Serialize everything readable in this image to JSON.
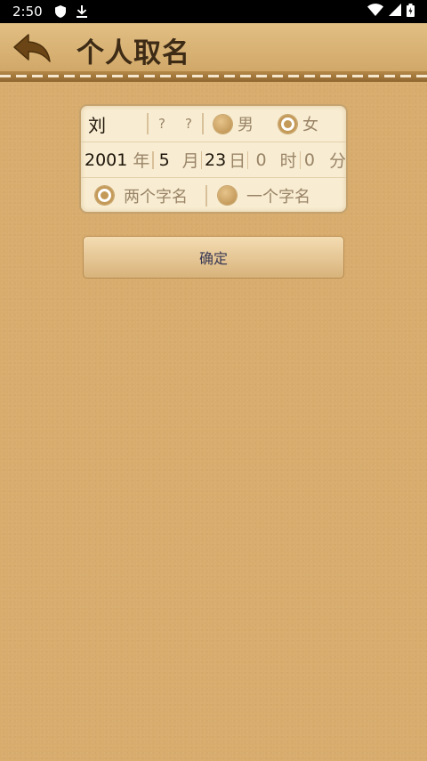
{
  "status": {
    "time": "2:50"
  },
  "header": {
    "title": "个人取名"
  },
  "form": {
    "surname": "刘",
    "given_placeholder_1": "?",
    "given_placeholder_2": "?",
    "gender_male": "男",
    "gender_female": "女",
    "gender_selected": "female",
    "year": "2001",
    "year_unit": "年",
    "month": "5",
    "month_unit": "月",
    "day": "23",
    "day_unit": "日",
    "hour": "0",
    "hour_unit": "时",
    "minute": "0",
    "minute_unit": "分",
    "two_char": "两个字名",
    "one_char": "一个字名",
    "char_selected": "two"
  },
  "confirm_label": "确定"
}
